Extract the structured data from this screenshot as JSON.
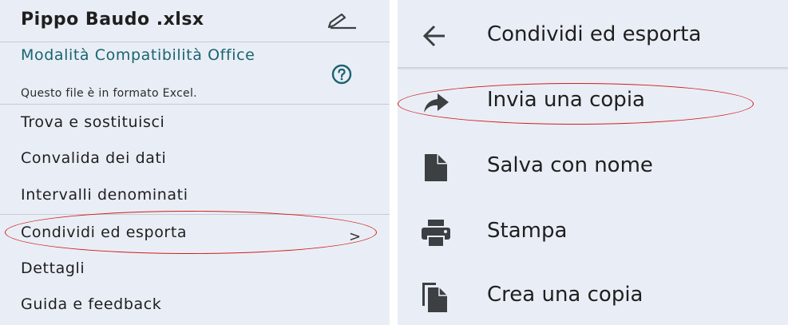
{
  "left_panel": {
    "file_title": "Pippo Baudo .xlsx",
    "compat_title": "Modalità Compatibilità Office",
    "compat_subtitle": "Questo file è in formato Excel.",
    "menu": [
      {
        "label": "Trova e sostituisci"
      },
      {
        "label": "Convalida dei dati"
      },
      {
        "label": "Intervalli denominati"
      },
      {
        "label": "Condividi ed esporta",
        "chevron": ">"
      },
      {
        "label": "Dettagli"
      },
      {
        "label": "Guida e feedback"
      }
    ],
    "icons": {
      "edit": "edit-pen-icon",
      "help": "help-circle-icon"
    }
  },
  "right_panel": {
    "header_title": "Condividi ed esporta",
    "back_icon": "arrow-back-icon",
    "items": [
      {
        "label": "Invia una copia",
        "icon": "share-arrow-icon"
      },
      {
        "label": "Salva con nome",
        "icon": "file-icon"
      },
      {
        "label": "Stampa",
        "icon": "printer-icon"
      },
      {
        "label": "Crea una copia",
        "icon": "copy-icon"
      }
    ]
  },
  "annotations": {
    "highlight_color": "#d11b1b"
  },
  "colors": {
    "panel_bg": "#e9eef6",
    "compat_text": "#1a6470",
    "icon": "#3c4043"
  }
}
